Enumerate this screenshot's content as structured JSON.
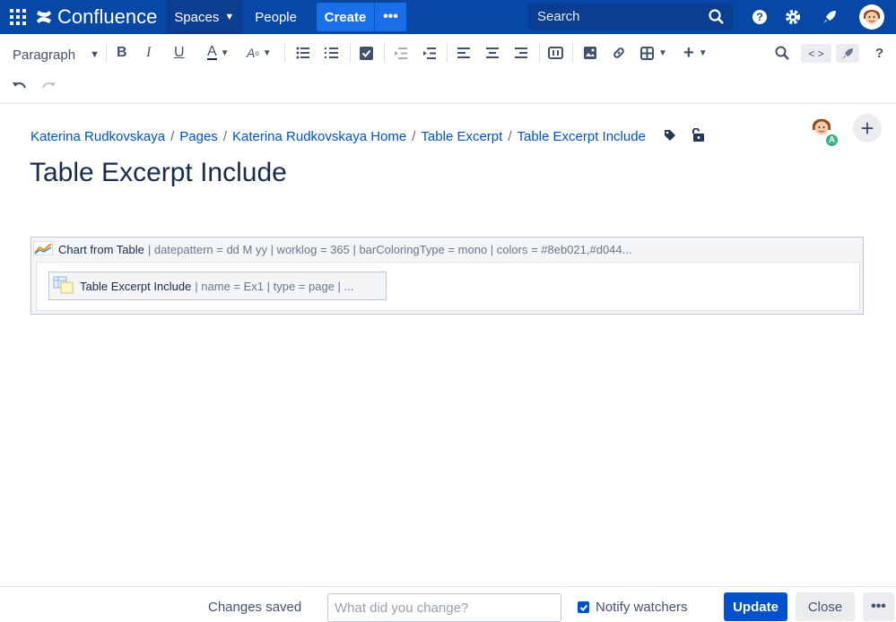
{
  "nav": {
    "logo": "Confluence",
    "spaces": "Spaces",
    "people": "People",
    "create": "Create",
    "search_placeholder": "Search"
  },
  "toolbar": {
    "paragraph": "Paragraph"
  },
  "breadcrumb": [
    "Katerina Rudkovskaya",
    "Pages",
    "Katerina Rudkovskaya Home",
    "Table Excerpt",
    "Table Excerpt Include"
  ],
  "page": {
    "title": "Table Excerpt Include"
  },
  "macros": {
    "outer_name": "Chart from Table",
    "outer_params": "| datepattern = dd M yy | worklog = 365 | barColoringType = mono | colors = #8eb021,#d044...",
    "inner_name": "Table Excerpt Include",
    "inner_params": "| name = Ex1 | type = page | ..."
  },
  "collaborator_badge": "A",
  "footer": {
    "status": "Changes saved",
    "change_placeholder": "What did you change?",
    "notify": "Notify watchers",
    "update": "Update",
    "close": "Close"
  },
  "colors": {
    "nav": "#0747a6",
    "primary": "#0052cc",
    "link": "#0052cc"
  }
}
